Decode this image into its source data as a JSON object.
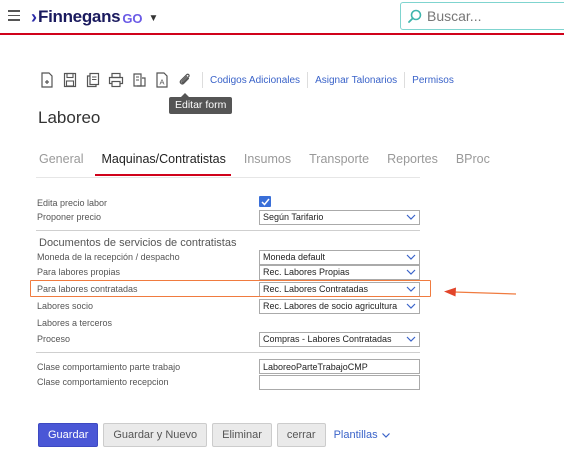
{
  "app": {
    "brand_name": "Finnegans",
    "brand_suffix": "GO",
    "search_placeholder": "Buscar..."
  },
  "toolbar": {
    "icons": [
      "new-document-icon",
      "save-icon",
      "copy-icon",
      "print-icon",
      "attach-document-icon",
      "edit-form-icon",
      "paperclip-icon"
    ],
    "links": [
      "Codigos Adicionales",
      "Asignar Talonarios",
      "Permisos"
    ],
    "tooltip": "Editar form"
  },
  "page": {
    "title": "Laboreo"
  },
  "tabs": [
    {
      "label": "General",
      "active": false
    },
    {
      "label": "Maquinas/Contratistas",
      "active": true
    },
    {
      "label": "Insumos",
      "active": false
    },
    {
      "label": "Transporte",
      "active": false
    },
    {
      "label": "Reportes",
      "active": false
    },
    {
      "label": "BProc",
      "active": false
    }
  ],
  "form": {
    "edita_precio_labor": {
      "label": "Edita precio labor",
      "checked": true
    },
    "proponer_precio": {
      "label": "Proponer precio",
      "value": "Según Tarifario"
    },
    "section_title": "Documentos de servicios de contratistas",
    "moneda": {
      "label": "Moneda de la recepción / despacho",
      "value": "Moneda default"
    },
    "labores_propias": {
      "label": "Para labores propias",
      "value": "Rec. Labores Propias"
    },
    "labores_contratadas": {
      "label": "Para labores contratadas",
      "value": "Rec. Labores Contratadas"
    },
    "labores_socio": {
      "label": "Labores socio",
      "value": "Rec. Labores de socio agricultura"
    },
    "labores_terceros": {
      "label": "Labores a terceros"
    },
    "proceso": {
      "label": "Proceso",
      "value": "Compras - Labores Contratadas"
    },
    "clase_parte_trabajo": {
      "label": "Clase comportamiento parte trabajo",
      "value": "LaboreoParteTrabajoCMP"
    },
    "clase_recepcion": {
      "label": "Clase comportamiento recepcion",
      "value": ""
    }
  },
  "buttons": {
    "guardar": "Guardar",
    "guardar_nuevo": "Guardar y Nuevo",
    "eliminar": "Eliminar",
    "cerrar": "cerrar",
    "plantillas": "Plantillas"
  },
  "colors": {
    "accent_red": "#d0021b",
    "primary_button": "#4a57d6",
    "link_blue": "#3a63c9",
    "highlight_orange": "#f07b3f"
  }
}
